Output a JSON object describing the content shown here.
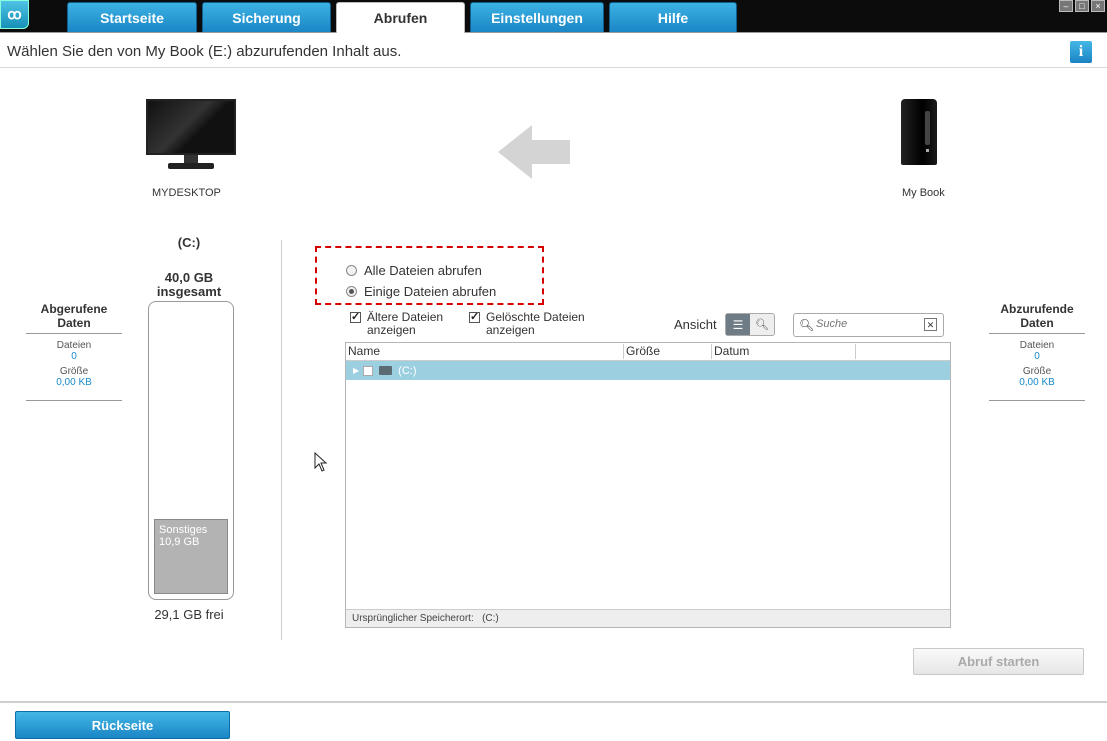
{
  "tabs": [
    {
      "label": "Startseite",
      "active": false
    },
    {
      "label": "Sicherung",
      "active": false
    },
    {
      "label": "Abrufen",
      "active": true
    },
    {
      "label": "Einstellungen",
      "active": false
    },
    {
      "label": "Hilfe",
      "active": false
    }
  ],
  "colors": {
    "accent": "#1b86c6",
    "selected_row": "#9ccfe0",
    "highlight_box": "#d40000",
    "value_text": "#1a8bc8"
  },
  "subtitle": "Wählen Sie den von My Book (E:) abzurufenden Inhalt aus.",
  "info_icon": "i",
  "source": {
    "name": "MYDESKTOP",
    "drive": "(C:)",
    "total": "40,0 GB",
    "total_label": "insgesamt",
    "used_label": "Sonstiges",
    "used_value": "10,9 GB",
    "free": "29,1 GB frei"
  },
  "target": {
    "name": "My Book"
  },
  "left_panel": {
    "title": "Abgerufene Daten",
    "files_label": "Dateien",
    "files_value": "0",
    "size_label": "Größe",
    "size_value": "0,00 KB"
  },
  "right_panel": {
    "title": "Abzurufende Daten",
    "files_label": "Dateien",
    "files_value": "0",
    "size_label": "Größe",
    "size_value": "0,00 KB"
  },
  "options": {
    "all_files": "Alle Dateien abrufen",
    "some_files": "Einige Dateien abrufen",
    "selected": "some_files"
  },
  "filters": {
    "older_line1": "Ältere Dateien",
    "older_line2": "anzeigen",
    "deleted_line1": "Gelöschte Dateien",
    "deleted_line2": "anzeigen",
    "older_checked": true,
    "deleted_checked": true
  },
  "view_label": "Ansicht",
  "search": {
    "placeholder": "Suche",
    "value": ""
  },
  "table": {
    "columns": [
      "Name",
      "Größe",
      "Datum"
    ],
    "rows": [
      {
        "name": "(C:)"
      }
    ],
    "footer_label": "Ursprünglicher Speicherort:",
    "footer_value": "(C:)"
  },
  "start_button": "Abruf starten",
  "back_button": "Rückseite"
}
